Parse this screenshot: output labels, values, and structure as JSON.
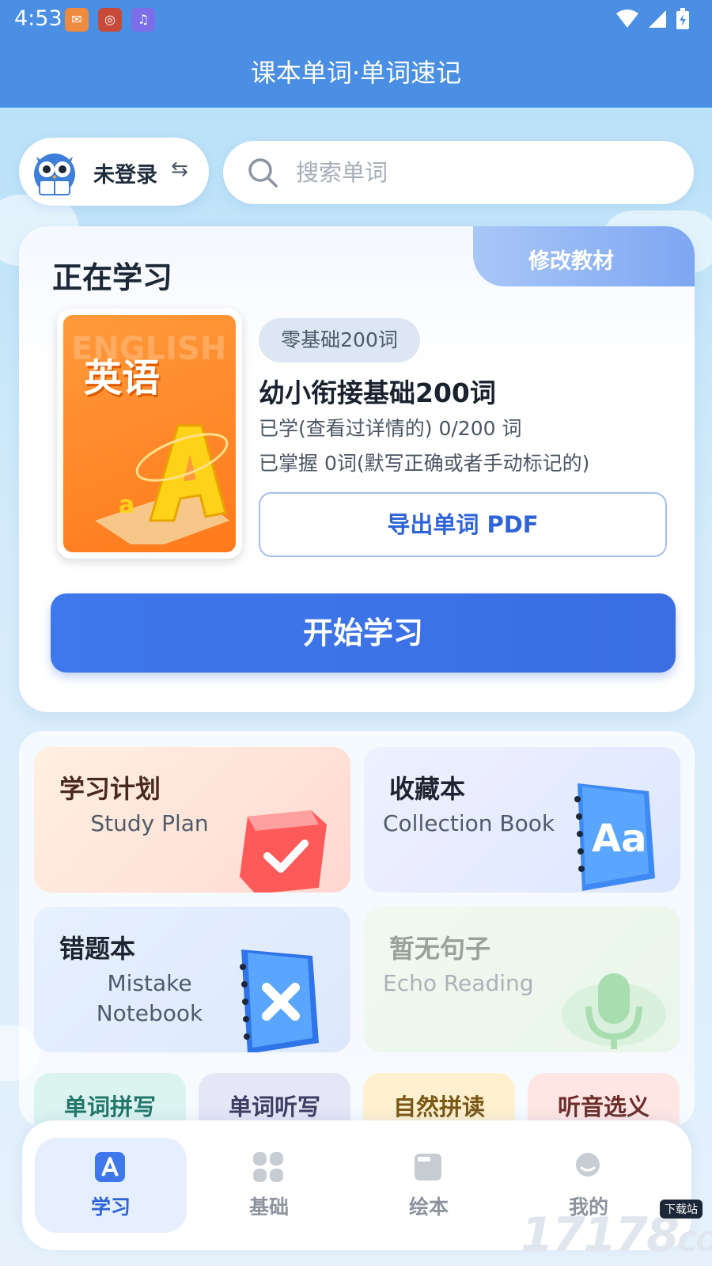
{
  "status_bar": {
    "time": "4:53"
  },
  "header": {
    "title": "课本单词·单词速记"
  },
  "account": {
    "label": "未登录"
  },
  "search": {
    "placeholder": "搜索单词"
  },
  "study_card": {
    "title": "正在学习",
    "edit_textbook": "修改教材",
    "book_cover_title": "英语",
    "book_cover_watermark": "ENGLISH",
    "level_badge": "零基础200词",
    "book_name": "幼小衔接基础200词",
    "learned_text": "已学(查看过详情的) 0/200 词",
    "mastered_text": "已掌握 0词(默写正确或者手动标记的)",
    "export_label": "导出单词 PDF",
    "start_label": "开始学习"
  },
  "features": [
    {
      "title": "学习计划",
      "subtitle": "Study Plan",
      "title_color": "#4a2a1e",
      "icon": "check-cube-icon"
    },
    {
      "title": "收藏本",
      "subtitle": "Collection Book",
      "title_color": "#1f2530",
      "icon": "aa-notebook-icon"
    },
    {
      "title": "错题本",
      "subtitle": "Mistake Notebook",
      "title_color": "#1f2530",
      "icon": "x-notebook-icon"
    },
    {
      "title": "暂无句子",
      "subtitle": "Echo Reading",
      "title_color": "#9aa19a",
      "icon": "microphone-icon"
    }
  ],
  "quick_actions": [
    "单词拼写",
    "单词听写",
    "自然拼读",
    "听音选义"
  ],
  "tabs": [
    {
      "label": "学习",
      "icon": "a-letter-icon",
      "active": true
    },
    {
      "label": "基础",
      "icon": "grid-icon",
      "active": false
    },
    {
      "label": "绘本",
      "icon": "book-icon",
      "active": false
    },
    {
      "label": "我的",
      "icon": "profile-icon",
      "active": false
    }
  ],
  "watermark": {
    "text": "17178",
    "domain": "COM",
    "tag": "下载站"
  },
  "colors": {
    "primary": "#3f78ec",
    "header": "#4a8fe3",
    "active_tab_bg": "#e6efff"
  }
}
